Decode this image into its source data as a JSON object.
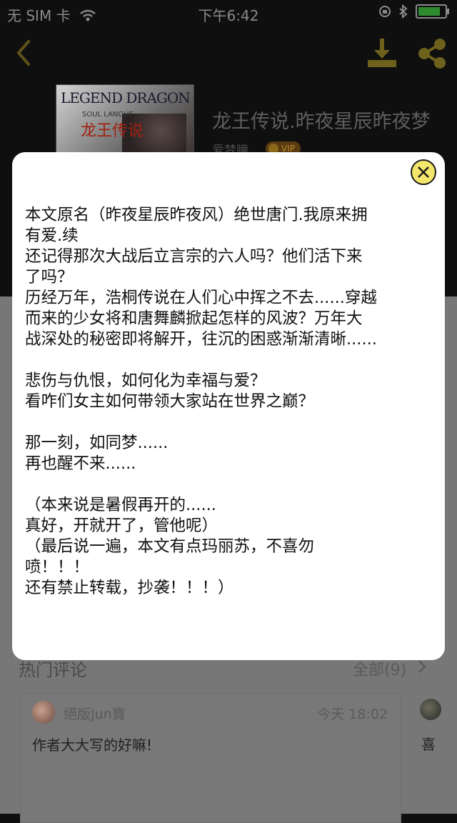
{
  "status_bar": {
    "carrier": "无 SIM 卡",
    "time": "下午6:42"
  },
  "nav": {
    "back_icon": "chevron-left-icon",
    "download_icon": "download-icon",
    "share_icon": "share-icon",
    "accent_color": "#c9a227"
  },
  "book": {
    "cover_title_en": "LEGEND DRAGON",
    "cover_subtitle_en": "SOUL LANGUE",
    "cover_title_cn": "龙王传说",
    "title": "龙王传说.昨夜星辰昨夜梦",
    "author": "爱梦瞳",
    "badge": "VIP"
  },
  "comments": {
    "header": "热门评论",
    "all_label": "全部(9)",
    "items": [
      {
        "user": "絕版Jun寶",
        "time": "今天 18:02",
        "text": "作者大大写的好嘛!"
      },
      {
        "text": "喜"
      }
    ]
  },
  "modal": {
    "close_icon": "close-icon",
    "close_color": "#f3e66a",
    "description": "本文原名（昨夜星辰昨夜风）绝世唐门.我原来拥\n有爱.续\n还记得那次大战后立言宗的六人吗？他们活下来\n了吗？\n历经万年，浩桐传说在人们心中挥之不去......穿越\n而来的少女将和唐舞麟掀起怎样的风波？万年大\n战深处的秘密即将解开，往沉的困惑渐渐清晰......\n\n悲伤与仇恨，如何化为幸福与爱？\n看咋们女主如何带领大家站在世界之巅？\n\n那一刻，如同梦......\n再也醒不来......\n\n（本来说是暑假再开的......\n真好，开就开了，管他呢）\n（最后说一遍，本文有点玛丽苏，不喜勿\n喷！！！\n还有禁止转载，抄袭！！！）"
  }
}
